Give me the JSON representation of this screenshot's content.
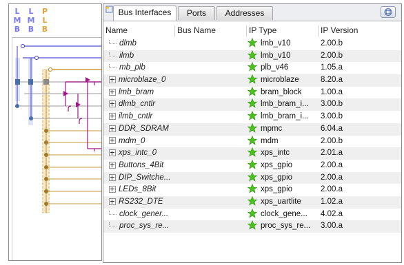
{
  "bus_panel": {
    "columns": [
      {
        "letters": [
          "L",
          "M",
          "B"
        ],
        "color": "#7b7bea"
      },
      {
        "letters": [
          "L",
          "M",
          "B"
        ],
        "color": "#7b7bea"
      },
      {
        "letters": [
          "P",
          "L",
          "B"
        ],
        "color": "#e0a542"
      }
    ]
  },
  "tabs": [
    {
      "label": "Bus Interfaces",
      "active": true
    },
    {
      "label": "Ports",
      "active": false
    },
    {
      "label": "Addresses",
      "active": false
    }
  ],
  "columns": {
    "name": "Name",
    "bus_name": "Bus Name",
    "ip_type": "IP Type",
    "ip_version": "IP Version"
  },
  "rows": [
    {
      "name": "dlmb",
      "expandable": false,
      "ip_type": "lmb_v10",
      "version": "2.00.b"
    },
    {
      "name": "ilmb",
      "expandable": false,
      "ip_type": "lmb_v10",
      "version": "2.00.b"
    },
    {
      "name": "mb_plb",
      "expandable": false,
      "ip_type": "plb_v46",
      "version": "1.05.a"
    },
    {
      "name": "microblaze_0",
      "expandable": true,
      "ip_type": "microblaze",
      "version": "8.20.a"
    },
    {
      "name": "lmb_bram",
      "expandable": true,
      "ip_type": "bram_block",
      "version": "1.00.a"
    },
    {
      "name": "dlmb_cntlr",
      "expandable": true,
      "ip_type": "lmb_bram_i...",
      "version": "3.00.b"
    },
    {
      "name": "ilmb_cntlr",
      "expandable": true,
      "ip_type": "lmb_bram_i...",
      "version": "3.00.b"
    },
    {
      "name": "DDR_SDRAM",
      "expandable": true,
      "ip_type": "mpmc",
      "version": "6.04.a"
    },
    {
      "name": "mdm_0",
      "expandable": true,
      "ip_type": "mdm",
      "version": "2.00.b"
    },
    {
      "name": "xps_intc_0",
      "expandable": true,
      "ip_type": "xps_intc",
      "version": "2.01.a"
    },
    {
      "name": "Buttons_4Bit",
      "expandable": true,
      "ip_type": "xps_gpio",
      "version": "2.00.a"
    },
    {
      "name": "DIP_Switche...",
      "expandable": true,
      "ip_type": "xps_gpio",
      "version": "2.00.a"
    },
    {
      "name": "LEDs_8Bit",
      "expandable": true,
      "ip_type": "xps_gpio",
      "version": "2.00.a"
    },
    {
      "name": "RS232_DTE",
      "expandable": true,
      "ip_type": "xps_uartlite",
      "version": "1.02.a"
    },
    {
      "name": "clock_gener...",
      "expandable": false,
      "ip_type": "clock_gene...",
      "version": "4.02.a"
    },
    {
      "name": "proc_sys_re...",
      "expandable": false,
      "ip_type": "proc_sys_re...",
      "version": "3.00.a"
    }
  ],
  "icons": {
    "ip_type": "green-star-icon",
    "tab_corner": "bus-interfaces-icon",
    "restore": "restore-window-icon"
  },
  "colors": {
    "lmb_bus": "#7b7bea",
    "plb_bus": "#e0a542",
    "connector": "#a0158c",
    "star": "#4cc21f",
    "row_alt": "#efefef"
  }
}
